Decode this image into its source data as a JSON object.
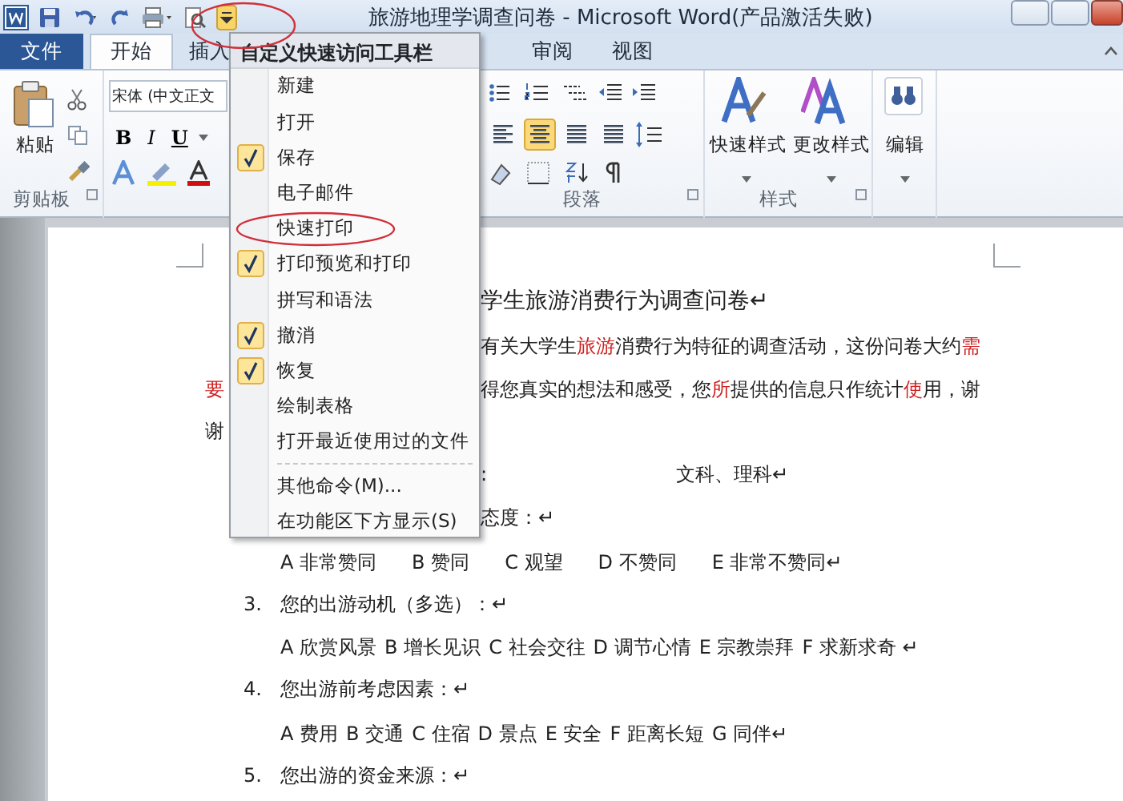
{
  "title_bar": {
    "title": "旅游地理学调查问卷 - Microsoft Word(产品激活失败)"
  },
  "tabs": [
    {
      "label": "文件",
      "kind": "file",
      "selected": false
    },
    {
      "label": "开始",
      "kind": "tab",
      "selected": true
    },
    {
      "label": "插入",
      "kind": "tab",
      "selected": false
    },
    {
      "label": "审阅",
      "kind": "tab",
      "selected": false
    },
    {
      "label": "视图",
      "kind": "tab",
      "selected": false
    }
  ],
  "ribbon": {
    "clipboard": {
      "paste": "粘贴",
      "label": "剪贴板"
    },
    "font": {
      "font_name": "宋体 (中文正文",
      "bold": "B",
      "italic": "I",
      "underline": "U"
    },
    "paragraph": {
      "label": "段落"
    },
    "styles": {
      "buttons": [
        "快速样式",
        "更改样式"
      ],
      "label": "样式"
    },
    "editing": {
      "button": "编辑"
    }
  },
  "quick_access_menu": {
    "title": "自定义快速访问工具栏",
    "items": [
      {
        "label": "新建",
        "checked": false
      },
      {
        "label": "打开",
        "checked": false
      },
      {
        "label": "保存",
        "checked": true
      },
      {
        "label": "电子邮件",
        "checked": false
      },
      {
        "label": "快速打印",
        "checked": false
      },
      {
        "label": "打印预览和打印",
        "checked": true
      },
      {
        "label": "拼写和语法",
        "checked": false
      },
      {
        "label": "撤消",
        "checked": true
      },
      {
        "label": "恢复",
        "checked": true
      },
      {
        "label": "绘制表格",
        "checked": false
      },
      {
        "label": "打开最近使用过的文件",
        "checked": false
      }
    ],
    "footer_items": [
      "其他命令(M)...",
      "在功能区下方显示(S)"
    ]
  },
  "document": {
    "lines": [
      {
        "kind": "title",
        "runs": [
          {
            "text": "学生旅游消费行为调查问卷↵",
            "red": false
          }
        ]
      },
      {
        "kind": "body",
        "runs": [
          {
            "text": "有关大学生",
            "red": false
          },
          {
            "text": "旅游",
            "red": true
          },
          {
            "text": "消费行为特征的调查活动，这份问卷大约",
            "red": false
          },
          {
            "text": "需",
            "red": true
          }
        ]
      },
      {
        "kind": "body",
        "left": [
          {
            "text": "要",
            "red": true
          }
        ],
        "runs": [
          {
            "text": "得您真实的想法和感受，您",
            "red": false
          },
          {
            "text": "所",
            "red": true
          },
          {
            "text": "提供的信息只作统计",
            "red": false
          },
          {
            "text": "使",
            "red": true
          },
          {
            "text": "用，谢",
            "red": false
          }
        ]
      },
      {
        "kind": "body",
        "left": [
          {
            "text": "谢",
            "red": false
          }
        ]
      },
      {
        "kind": "body",
        "runs": [
          {
            "text": ":",
            "red": false
          }
        ],
        "tail": "文科、理科↵"
      },
      {
        "kind": "body",
        "runs": [
          {
            "text": "态度：↵",
            "red": false
          }
        ]
      },
      {
        "kind": "options",
        "options": [
          "A 非常赞同",
          "B 赞同",
          "C 观望",
          "D 不赞同",
          "E 非常不赞同↵"
        ]
      },
      {
        "kind": "question",
        "number": "3.",
        "text": "您的出游动机（多选）：↵"
      },
      {
        "kind": "options",
        "options": [
          "A 欣赏风景",
          "B 增长见识",
          "C 社会交往",
          "D 调节心情",
          "E 宗教崇拜",
          "F 求新求奇 ↵"
        ]
      },
      {
        "kind": "question",
        "number": "4.",
        "text": "您出游前考虑因素：↵"
      },
      {
        "kind": "options",
        "options": [
          "A 费用",
          "B 交通",
          "C 住宿",
          "D 景点",
          "E 安全",
          "F 距离长短",
          "G 同伴↵"
        ]
      },
      {
        "kind": "question",
        "number": "5.",
        "text": "您出游的资金来源：↵"
      }
    ]
  }
}
